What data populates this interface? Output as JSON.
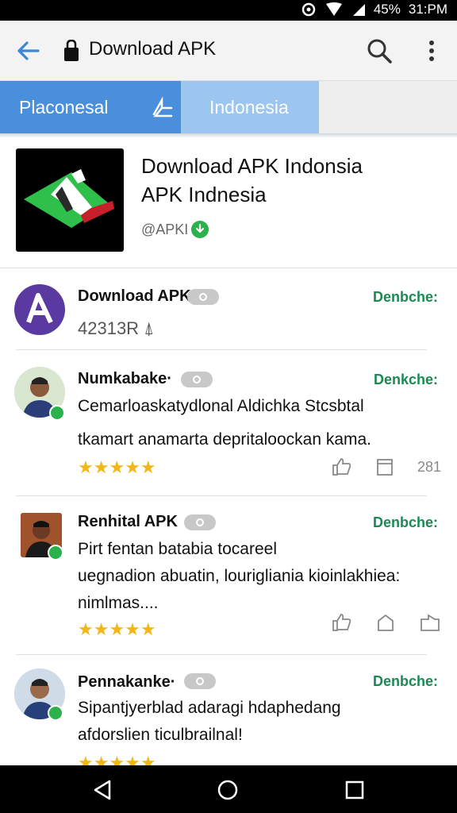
{
  "status_bar": {
    "battery": "45%",
    "time": "31:PM"
  },
  "app_bar": {
    "title": "Download APK"
  },
  "tabs": [
    {
      "label": "Placonesal"
    },
    {
      "label": "Indonesia"
    }
  ],
  "app": {
    "name": "Download APK Indonsia",
    "subtitle": "APK Indnesia",
    "publisher": "@APKI"
  },
  "reviews": [
    {
      "name": "Download APK",
      "action": "Denbche:",
      "body_lines": [
        "42313R ⍋"
      ],
      "stars": "",
      "count": ""
    },
    {
      "name": "Numkabake·",
      "action": "Denkche:",
      "body_lines": [
        "Cemarloaskatydlonal Aldichka Stcsbtal",
        "tkamart anamarta depritaloockan kama."
      ],
      "stars": "★★★★★",
      "count": "281"
    },
    {
      "name": "Renhital APK",
      "action": "Denbche:",
      "body_lines": [
        "Pirt fentan batabia tocareel",
        "uegnadion abuatin, lourigliania kioinlakhiea:",
        "nimlmas...."
      ],
      "stars": "★★★★★",
      "count": ""
    },
    {
      "name": "Pennakanke·",
      "action": "Denbche:",
      "body_lines": [
        "Sipantjyerblad adaragi hdaphedang",
        "afdorslien ticulbrailnal!"
      ],
      "stars": "★★★★★",
      "count": ""
    }
  ],
  "colors": {
    "tab_active": "#4a8fdc",
    "tab_inactive": "#9cc6ef",
    "accent_green": "#1a8a52",
    "star": "#f2b619"
  }
}
